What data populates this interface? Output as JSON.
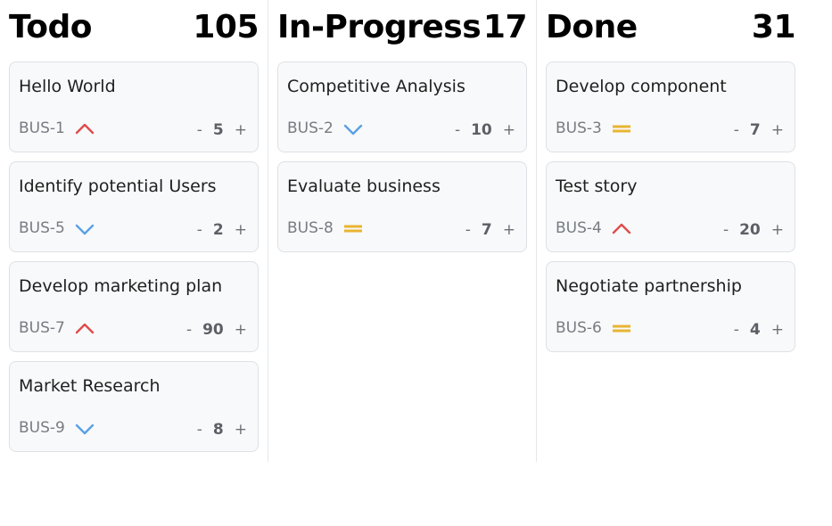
{
  "colors": {
    "high": "#e04b4b",
    "low": "#5aa0e6",
    "medium": "#e9b531"
  },
  "stepper": {
    "minus": "-",
    "plus": "+"
  },
  "columns": [
    {
      "title": "Todo",
      "total": "105",
      "cards": [
        {
          "title": "Hello World",
          "id": "BUS-1",
          "priority": "high",
          "value": "5"
        },
        {
          "title": "Identify potential Users",
          "id": "BUS-5",
          "priority": "low",
          "value": "2"
        },
        {
          "title": "Develop marketing plan",
          "id": "BUS-7",
          "priority": "high",
          "value": "90"
        },
        {
          "title": "Market Research",
          "id": "BUS-9",
          "priority": "low",
          "value": "8"
        }
      ]
    },
    {
      "title": "In-Progress",
      "total": "17",
      "cards": [
        {
          "title": "Competitive Analysis",
          "id": "BUS-2",
          "priority": "low",
          "value": "10"
        },
        {
          "title": "Evaluate business",
          "id": "BUS-8",
          "priority": "medium",
          "value": "7"
        }
      ]
    },
    {
      "title": "Done",
      "total": "31",
      "cards": [
        {
          "title": "Develop component",
          "id": "BUS-3",
          "priority": "medium",
          "value": "7"
        },
        {
          "title": "Test story",
          "id": "BUS-4",
          "priority": "high",
          "value": "20"
        },
        {
          "title": "Negotiate partnership",
          "id": "BUS-6",
          "priority": "medium",
          "value": "4"
        }
      ]
    }
  ]
}
